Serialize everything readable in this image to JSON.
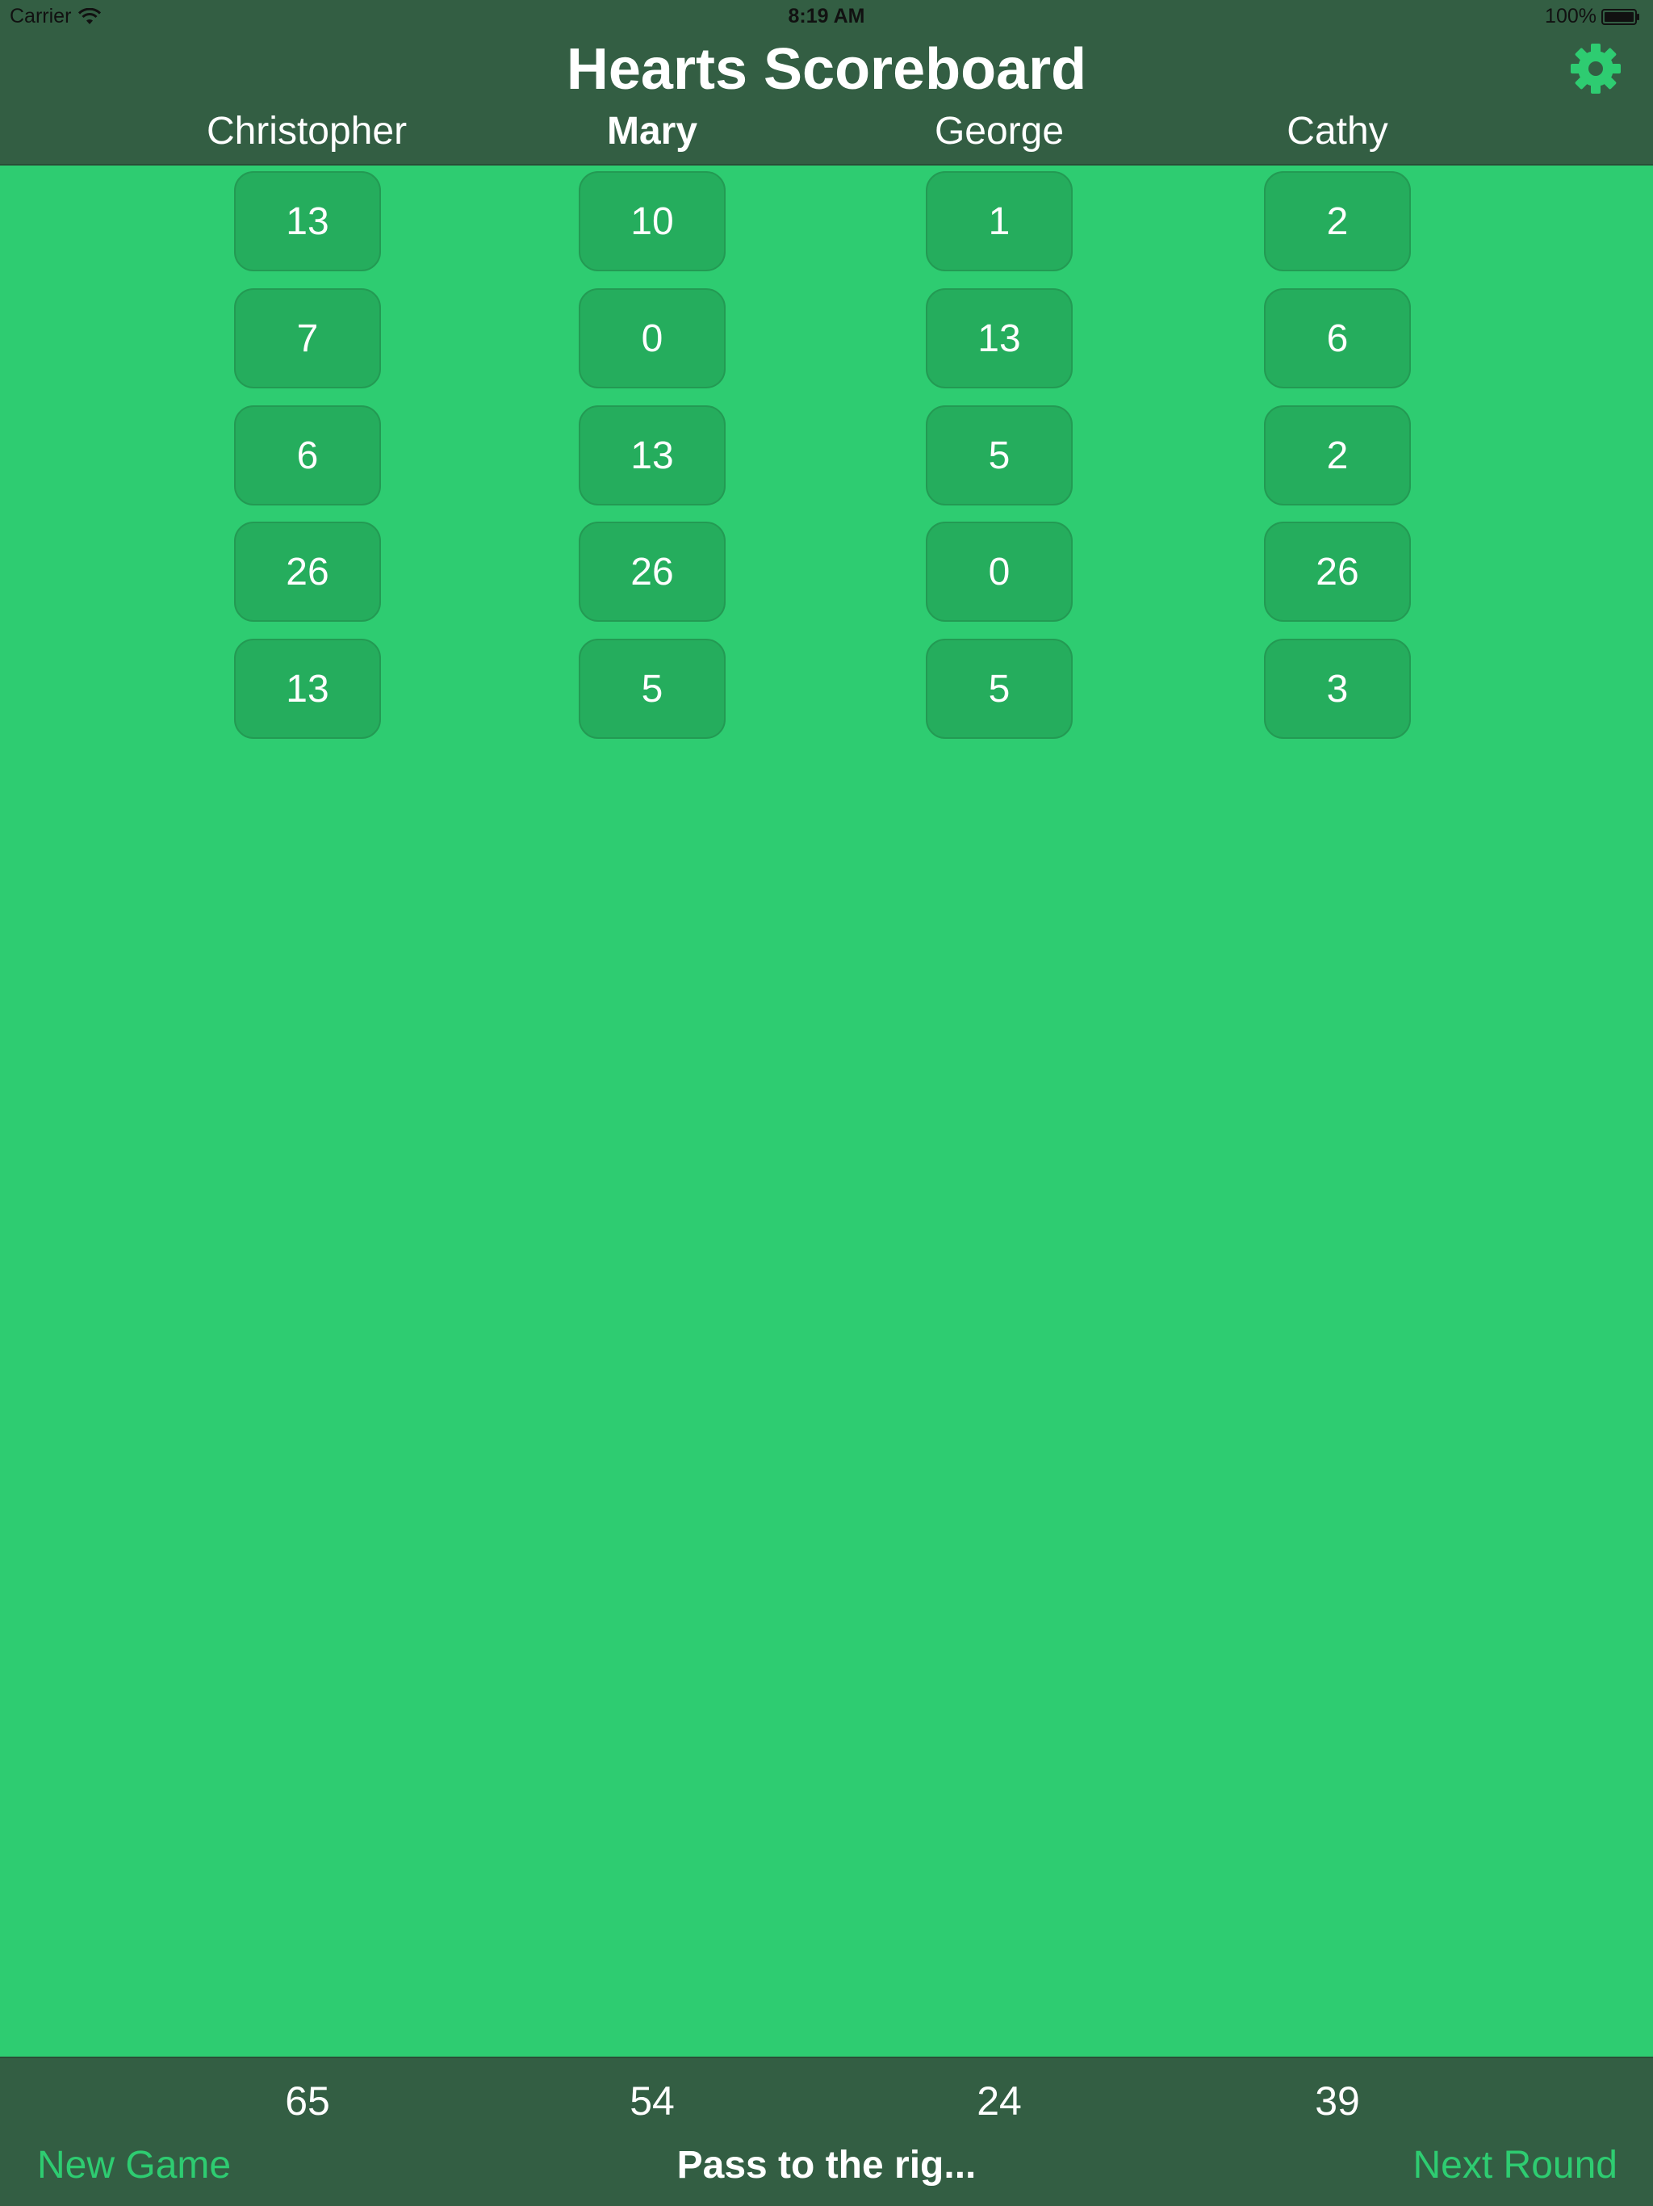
{
  "status_bar": {
    "carrier": "Carrier",
    "time": "8:19 AM",
    "battery": "100%",
    "wifi_icon": "wifi-icon",
    "battery_icon": "battery-icon"
  },
  "header": {
    "title": "Hearts Scoreboard",
    "settings_icon": "gear-icon"
  },
  "players": [
    {
      "name": "Christopher",
      "current": false
    },
    {
      "name": "Mary",
      "current": true
    },
    {
      "name": "George",
      "current": false
    },
    {
      "name": "Cathy",
      "current": false
    }
  ],
  "rounds": [
    [
      "13",
      "10",
      "1",
      "2"
    ],
    [
      "7",
      "0",
      "13",
      "6"
    ],
    [
      "6",
      "13",
      "5",
      "2"
    ],
    [
      "26",
      "26",
      "0",
      "26"
    ],
    [
      "13",
      "5",
      "5",
      "3"
    ]
  ],
  "totals": [
    "65",
    "54",
    "24",
    "39"
  ],
  "footer": {
    "new_game_label": "New Game",
    "pass_direction": "Pass to the rig...",
    "next_round_label": "Next Round"
  },
  "colors": {
    "background": "#2ecc71",
    "bar": "#335e43",
    "cell": "#25ad5d",
    "accent": "#2ecc71",
    "text": "#ffffff"
  }
}
